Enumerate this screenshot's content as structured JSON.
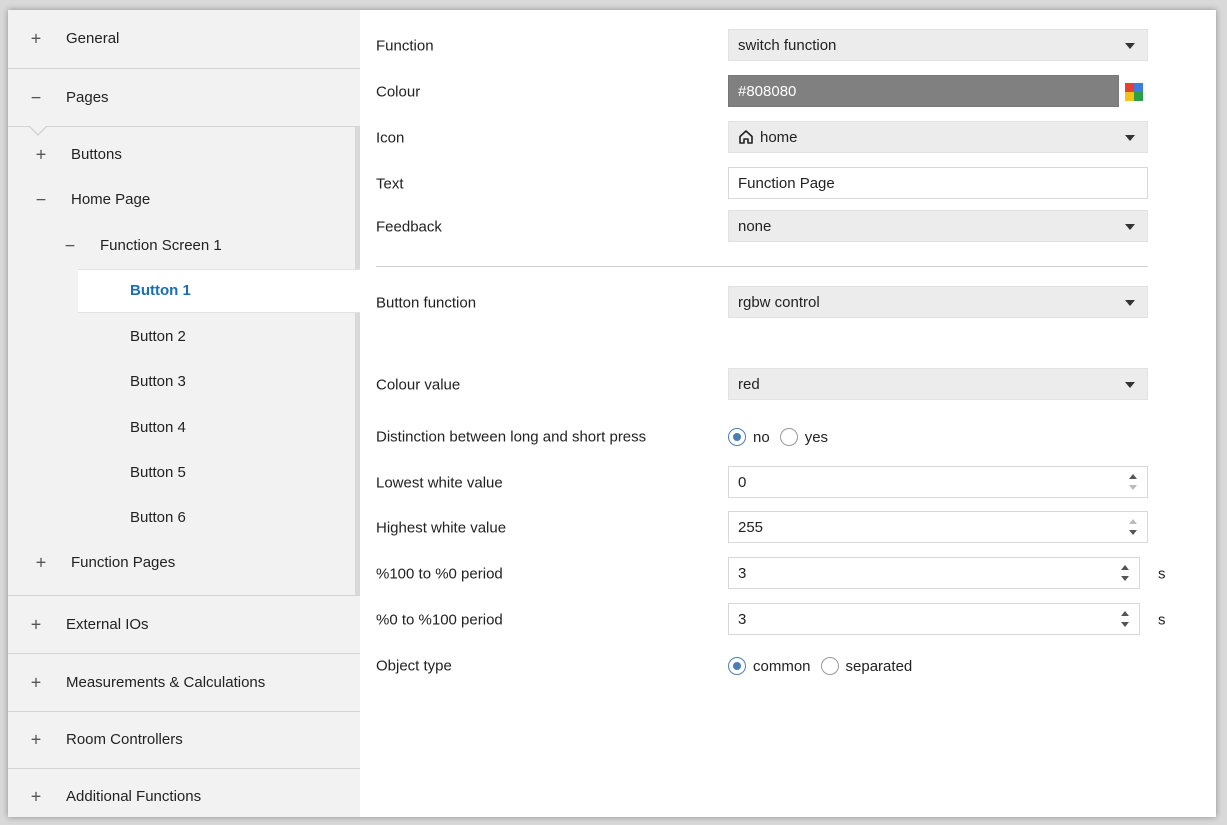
{
  "sidebar": {
    "general": "General",
    "pages": "Pages",
    "tree": {
      "buttons": "Buttons",
      "home_page": "Home Page",
      "function_screen_1": "Function Screen 1",
      "button_1": "Button 1",
      "button_2": "Button 2",
      "button_3": "Button 3",
      "button_4": "Button 4",
      "button_5": "Button 5",
      "button_6": "Button 6",
      "function_pages": "Function Pages"
    },
    "external_ios": "External IOs",
    "measurements": "Measurements & Calculations",
    "room_controllers": "Room Controllers",
    "additional_functions": "Additional Functions",
    "signs": {
      "plus": "+",
      "minus": "−"
    }
  },
  "form": {
    "function": {
      "label": "Function",
      "value": "switch function"
    },
    "colour": {
      "label": "Colour",
      "value": "#808080"
    },
    "icon": {
      "label": "Icon",
      "value": "home",
      "icon": "home-icon"
    },
    "text": {
      "label": "Text",
      "value": "Function Page"
    },
    "feedback": {
      "label": "Feedback",
      "value": "none"
    },
    "button_function": {
      "label": "Button function",
      "value": "rgbw control"
    },
    "colour_value": {
      "label": "Colour value",
      "value": "red"
    },
    "distinction": {
      "label": "Distinction between long and short press",
      "options": [
        "no",
        "yes"
      ],
      "selected": "no"
    },
    "lowest_white": {
      "label": "Lowest white value",
      "value": "0"
    },
    "highest_white": {
      "label": "Highest white value",
      "value": "255"
    },
    "period_100_0": {
      "label": "%100 to %0 period",
      "value": "3",
      "unit": "s"
    },
    "period_0_100": {
      "label": "%0 to %100 period",
      "value": "3",
      "unit": "s"
    },
    "object_type": {
      "label": "Object type",
      "options": [
        "common",
        "separated"
      ],
      "selected": "common"
    }
  },
  "colors": {
    "accent": "#1a6fb0",
    "radio": "#4a7fb5",
    "colour_swatch": "#808080",
    "palette": [
      "#e8402f",
      "#3b7de0",
      "#f4c21b",
      "#2f9e45"
    ]
  }
}
